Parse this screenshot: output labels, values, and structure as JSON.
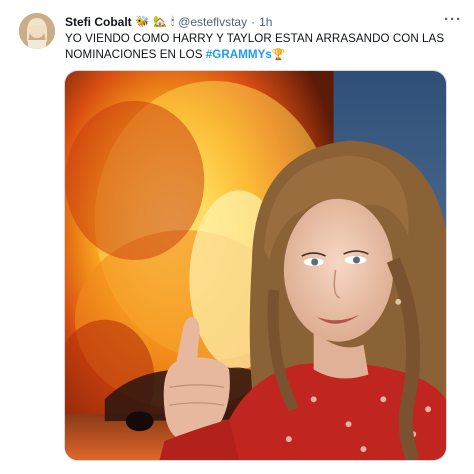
{
  "tweet": {
    "display_name": "Stefi Cobalt",
    "name_emojis": [
      "🐝",
      "🏡",
      "🕯"
    ],
    "handle": "@esteflvstay",
    "separator": "·",
    "time": "1h",
    "more_label": "···",
    "text_line1": "YO VIENDO COMO HARRY Y TAYLOR ESTAN ARRASANDO CON LAS",
    "text_line2_prefix": "NOMINACIONES EN LOS ",
    "hashtag": "#GRAMMYs",
    "trailing_emoji": "🏆"
  },
  "media": {
    "alt_description": "meme",
    "colors": {
      "fire_core": "#fff2a6",
      "fire_mid": "#f7a21d",
      "fire_outer": "#d94e11",
      "sky": "#3d5f87",
      "dress": "#c0251f"
    }
  },
  "icons": {
    "avatar": "avatar-image",
    "more": "more-options-icon"
  }
}
